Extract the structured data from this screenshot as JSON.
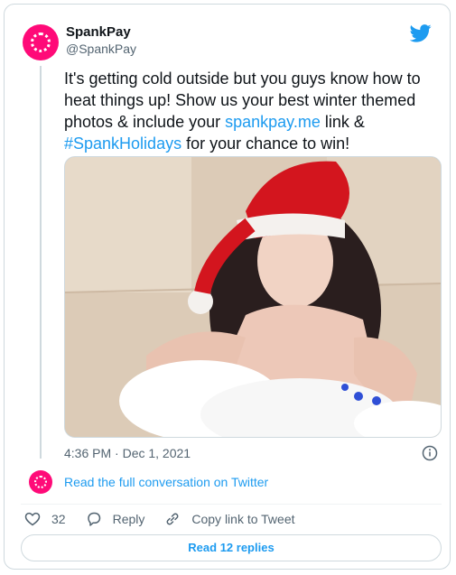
{
  "author": {
    "name": "SpankPay",
    "handle": "@SpankPay"
  },
  "tweet": {
    "text_part1": "It's getting cold outside but you guys know how to heat things up! Show us your best winter themed photos & include your ",
    "link": "spankpay.me",
    "text_part2": " link & ",
    "hashtag": "#SpankHolidays",
    "text_part3": " for your chance to win!",
    "timestamp": "4:36 PM · Dec 1, 2021"
  },
  "conversation_link": "Read the full conversation on Twitter",
  "actions": {
    "like_count": "32",
    "reply_label": "Reply",
    "copy_label": "Copy link to Tweet"
  },
  "read_replies_label": "Read 12 replies",
  "colors": {
    "brand_pink": "#ff0a78",
    "link_blue": "#1d9bf0",
    "muted": "#536471"
  }
}
